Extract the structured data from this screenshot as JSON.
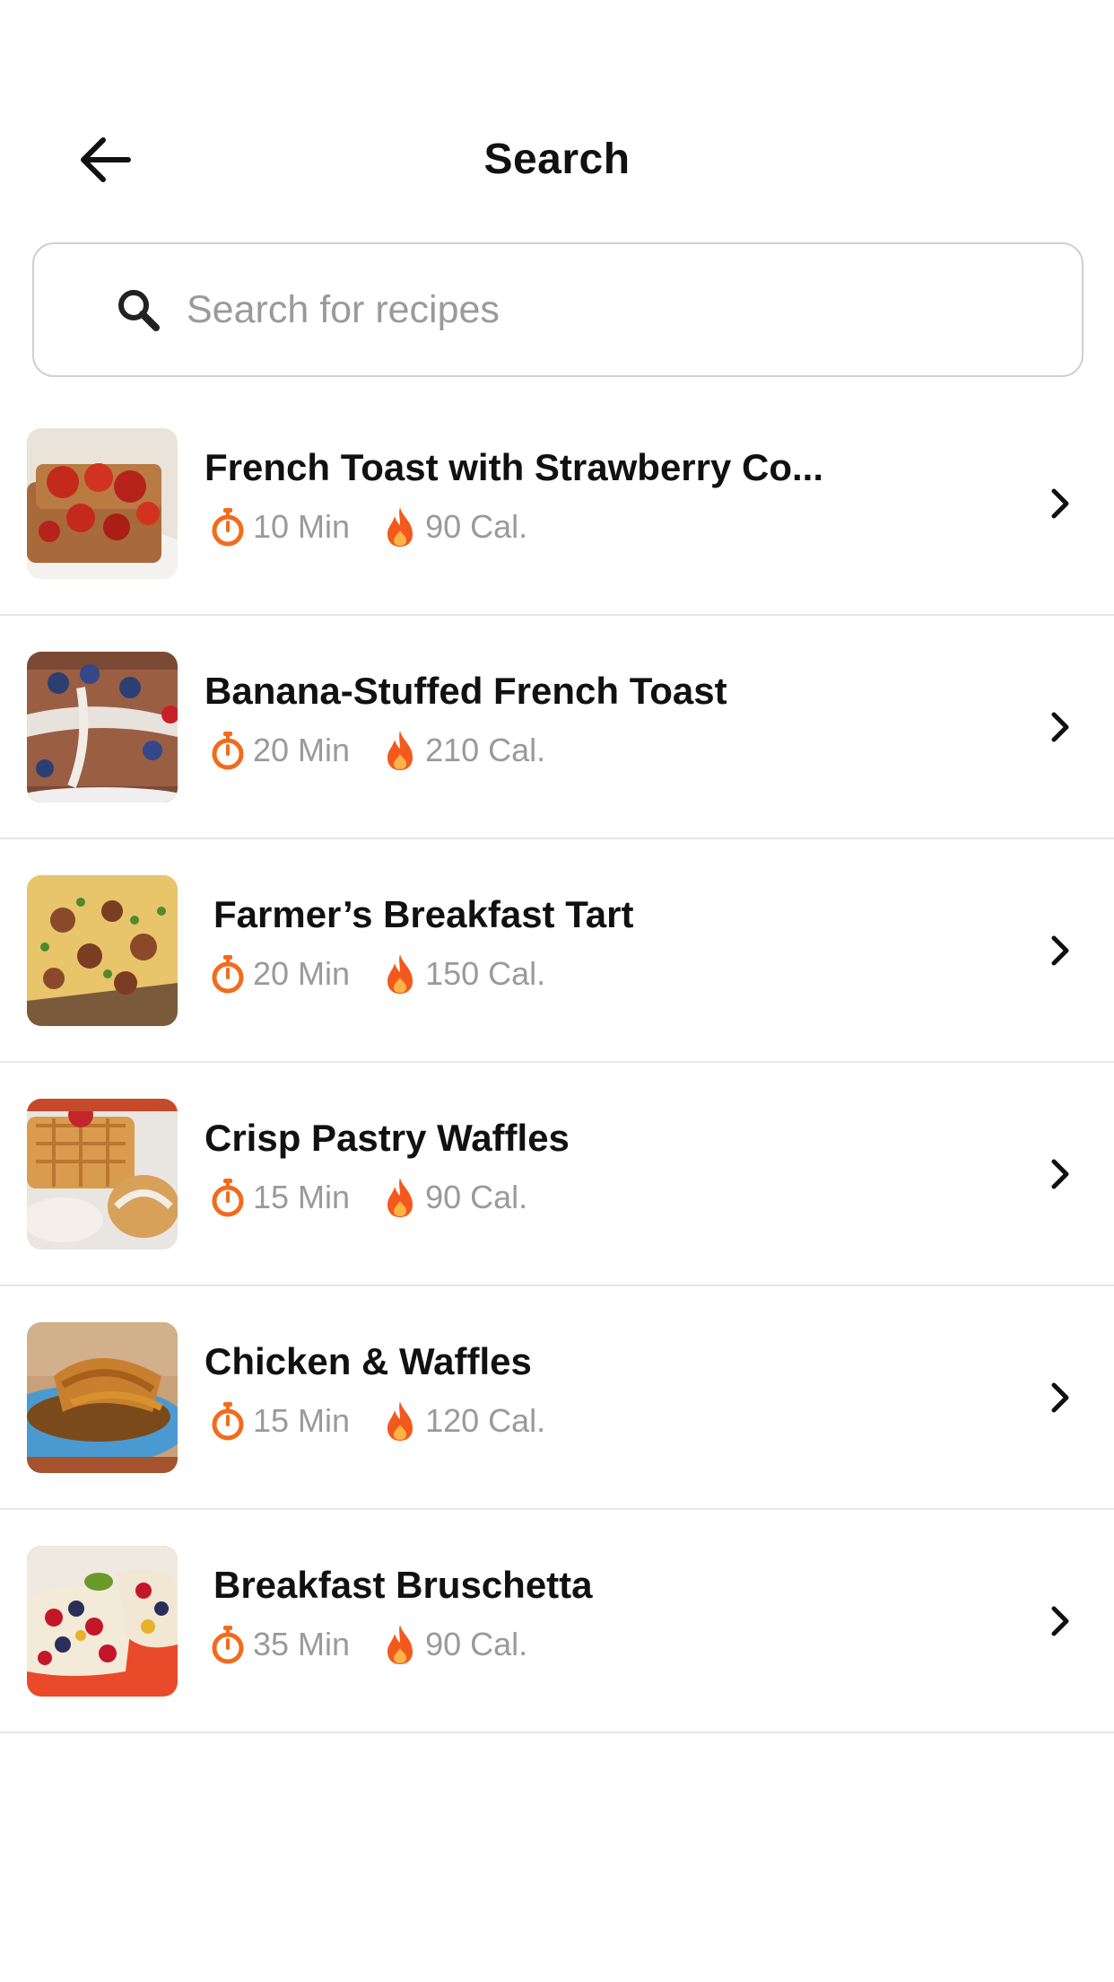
{
  "header": {
    "title": "Search",
    "back_icon": "arrow-left-icon"
  },
  "search": {
    "placeholder": "Search for recipes",
    "value": "",
    "icon": "search-icon"
  },
  "colors": {
    "accent": "#f26b1d",
    "flame": "#f25a1d",
    "muted_text": "#9a9a9a",
    "divider": "#e6e6e6"
  },
  "recipes": [
    {
      "title": "French Toast with Strawberry Co...",
      "time": "10 Min",
      "calories": "90 Cal."
    },
    {
      "title": "Banana-Stuffed French Toast",
      "time": "20 Min",
      "calories": "210 Cal."
    },
    {
      "title": "Farmer’s Breakfast Tart",
      "time": "20 Min",
      "calories": "150 Cal."
    },
    {
      "title": "Crisp Pastry Waffles",
      "time": "15 Min",
      "calories": "90 Cal."
    },
    {
      "title": "Chicken & Waffles",
      "time": "15 Min",
      "calories": "120 Cal."
    },
    {
      "title": "Breakfast Bruschetta",
      "time": "35 Min",
      "calories": "90 Cal."
    }
  ]
}
